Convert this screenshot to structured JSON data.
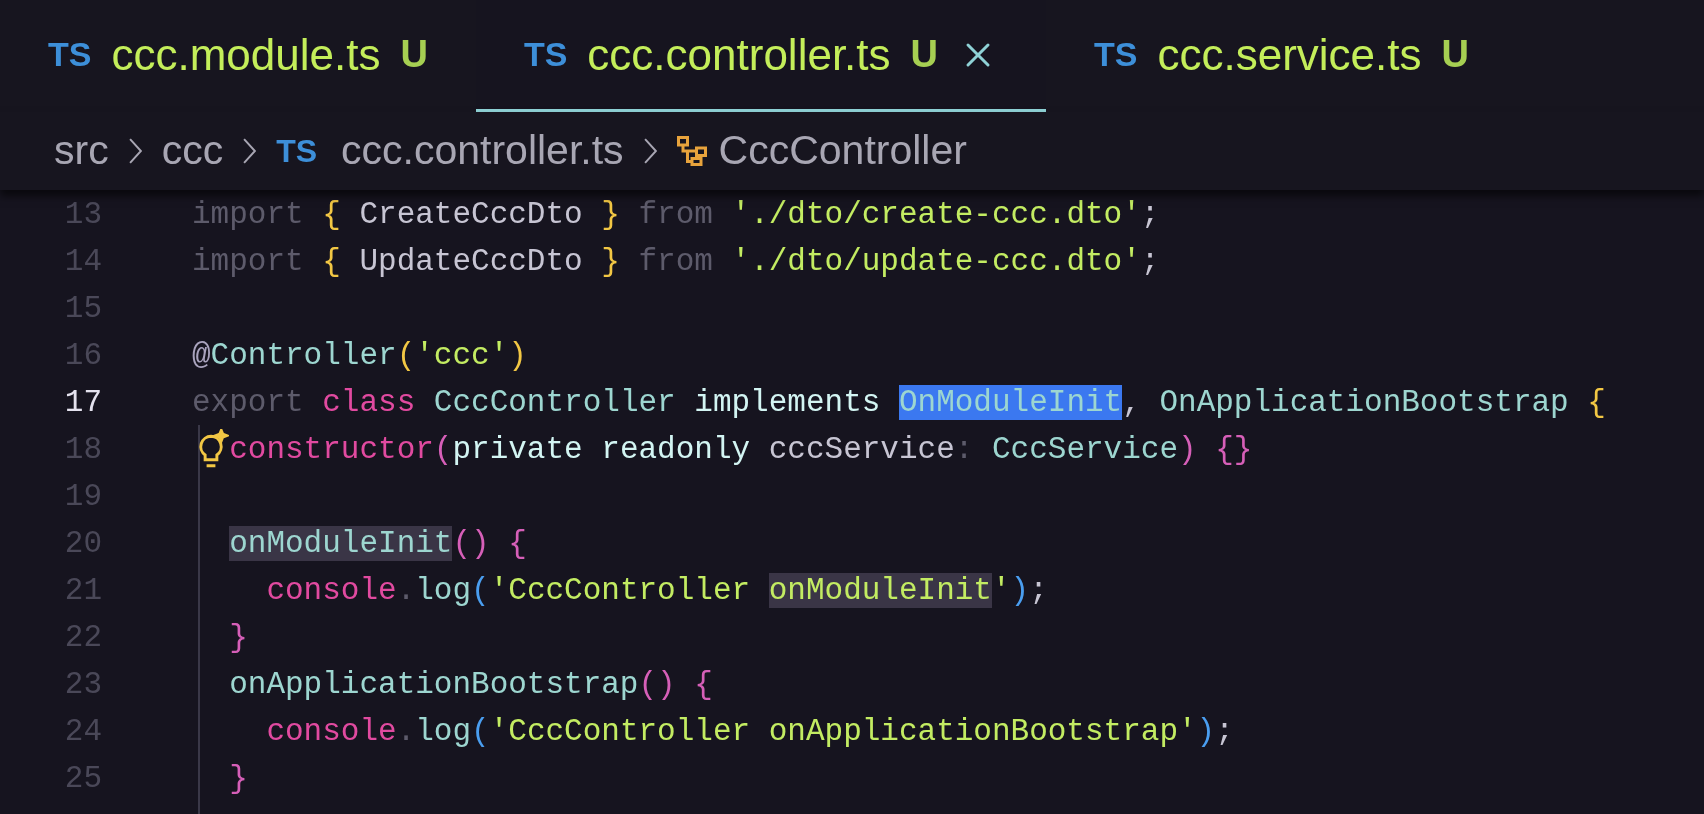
{
  "tabs": [
    {
      "icon_label": "TS",
      "name": "ccc.module.ts",
      "status": "U",
      "selected": false
    },
    {
      "icon_label": "TS",
      "name": "ccc.controller.ts",
      "status": "U",
      "selected": true
    },
    {
      "icon_label": "TS",
      "name": "ccc.service.ts",
      "status": "U",
      "selected": false
    }
  ],
  "breadcrumb": [
    {
      "kind": "folder",
      "text": "src"
    },
    {
      "kind": "folder",
      "text": "ccc"
    },
    {
      "kind": "file",
      "icon_label": "TS",
      "text": "ccc.controller.ts"
    },
    {
      "kind": "class",
      "text": "CccController"
    }
  ],
  "lines": [
    {
      "number": "13",
      "active": false,
      "hint": false,
      "tokens": [
        {
          "text": "import ",
          "kind": "dim",
          "selected": false,
          "occurrence": false
        },
        {
          "text": "{",
          "kind": "brace",
          "selected": false,
          "occurrence": false
        },
        {
          "text": " CreateCccDto ",
          "kind": "ident",
          "selected": false,
          "occurrence": false
        },
        {
          "text": "}",
          "kind": "brace",
          "selected": false,
          "occurrence": false
        },
        {
          "text": " from ",
          "kind": "dim",
          "selected": false,
          "occurrence": false
        },
        {
          "text": "'./dto/create-ccc.dto'",
          "kind": "string",
          "selected": false,
          "occurrence": false
        },
        {
          "text": ";",
          "kind": "ident",
          "selected": false,
          "occurrence": false
        }
      ]
    },
    {
      "number": "14",
      "active": false,
      "hint": false,
      "tokens": [
        {
          "text": "import ",
          "kind": "dim",
          "selected": false,
          "occurrence": false
        },
        {
          "text": "{",
          "kind": "brace",
          "selected": false,
          "occurrence": false
        },
        {
          "text": " UpdateCccDto ",
          "kind": "ident",
          "selected": false,
          "occurrence": false
        },
        {
          "text": "}",
          "kind": "brace",
          "selected": false,
          "occurrence": false
        },
        {
          "text": " from ",
          "kind": "dim",
          "selected": false,
          "occurrence": false
        },
        {
          "text": "'./dto/update-ccc.dto'",
          "kind": "string",
          "selected": false,
          "occurrence": false
        },
        {
          "text": ";",
          "kind": "ident",
          "selected": false,
          "occurrence": false
        }
      ]
    },
    {
      "number": "15",
      "active": false,
      "hint": false
    },
    {
      "number": "16",
      "active": false,
      "hint": false,
      "tokens": [
        {
          "text": "@",
          "kind": "decorator",
          "selected": false,
          "occurrence": false
        },
        {
          "text": "Controller",
          "kind": "type",
          "selected": false,
          "occurrence": false
        },
        {
          "text": "(",
          "kind": "brace",
          "selected": false,
          "occurrence": false
        },
        {
          "text": "'ccc'",
          "kind": "string",
          "selected": false,
          "occurrence": false
        },
        {
          "text": ")",
          "kind": "brace",
          "selected": false,
          "occurrence": false
        }
      ]
    },
    {
      "number": "17",
      "active": true,
      "hint": false,
      "tokens": [
        {
          "text": "export ",
          "kind": "dim",
          "selected": false,
          "occurrence": false
        },
        {
          "text": "class ",
          "kind": "keyword",
          "selected": false,
          "occurrence": false
        },
        {
          "text": "CccController ",
          "kind": "type",
          "selected": false,
          "occurrence": false
        },
        {
          "text": "implements ",
          "kind": "modifier",
          "selected": false,
          "occurrence": false
        },
        {
          "text": "OnModuleInit",
          "kind": "type",
          "selected": true,
          "occurrence": false
        },
        {
          "text": ", ",
          "kind": "ident",
          "selected": false,
          "occurrence": false
        },
        {
          "text": "OnApplicationBootstrap ",
          "kind": "type",
          "selected": false,
          "occurrence": false
        },
        {
          "text": "{",
          "kind": "brace",
          "selected": false,
          "occurrence": false
        }
      ],
      "children": [
        {
          "number": "18",
          "active": false,
          "hint": true,
          "tokens": [
            {
              "text": "constructor",
              "kind": "keyword",
              "selected": false,
              "occurrence": false
            },
            {
              "text": "(",
              "kind": "paren-pink",
              "selected": false,
              "occurrence": false
            },
            {
              "text": "private readonly ",
              "kind": "modifier",
              "selected": false,
              "occurrence": false
            },
            {
              "text": "cccService",
              "kind": "ident",
              "selected": false,
              "occurrence": false
            },
            {
              "text": ": ",
              "kind": "dim",
              "selected": false,
              "occurrence": false
            },
            {
              "text": "CccService",
              "kind": "type",
              "selected": false,
              "occurrence": false
            },
            {
              "text": ") {}",
              "kind": "paren-pink",
              "selected": false,
              "occurrence": false
            }
          ]
        },
        {
          "number": "19",
          "active": false,
          "hint": false
        },
        {
          "number": "20",
          "active": false,
          "hint": false,
          "tokens": [
            {
              "text": "onModuleInit",
              "kind": "type",
              "selected": false,
              "occurrence": true
            },
            {
              "text": "() {",
              "kind": "paren-pink",
              "selected": false,
              "occurrence": false
            }
          ],
          "children": [
            {
              "number": "21",
              "active": false,
              "hint": false,
              "tokens": [
                {
                  "text": "console",
                  "kind": "keyword",
                  "selected": false,
                  "occurrence": false
                },
                {
                  "text": ".",
                  "kind": "dim",
                  "selected": false,
                  "occurrence": false
                },
                {
                  "text": "log",
                  "kind": "type",
                  "selected": false,
                  "occurrence": false
                },
                {
                  "text": "(",
                  "kind": "paren-blue",
                  "selected": false,
                  "occurrence": false
                },
                {
                  "text": "'CccController ",
                  "kind": "string",
                  "selected": false,
                  "occurrence": false
                },
                {
                  "text": "onModuleInit",
                  "kind": "string",
                  "selected": false,
                  "occurrence": true
                },
                {
                  "text": "'",
                  "kind": "string",
                  "selected": false,
                  "occurrence": false
                },
                {
                  "text": ")",
                  "kind": "paren-blue",
                  "selected": false,
                  "occurrence": false
                },
                {
                  "text": ";",
                  "kind": "ident",
                  "selected": false,
                  "occurrence": false
                }
              ]
            }
          ]
        },
        {
          "number": "22",
          "active": false,
          "hint": false,
          "tokens": [
            {
              "text": "}",
              "kind": "paren-pink",
              "selected": false,
              "occurrence": false
            }
          ]
        },
        {
          "number": "23",
          "active": false,
          "hint": false,
          "tokens": [
            {
              "text": "onApplicationBootstrap",
              "kind": "type",
              "selected": false,
              "occurrence": false
            },
            {
              "text": "() {",
              "kind": "paren-pink",
              "selected": false,
              "occurrence": false
            }
          ],
          "children": [
            {
              "number": "24",
              "active": false,
              "hint": false,
              "tokens": [
                {
                  "text": "console",
                  "kind": "keyword",
                  "selected": false,
                  "occurrence": false
                },
                {
                  "text": ".",
                  "kind": "dim",
                  "selected": false,
                  "occurrence": false
                },
                {
                  "text": "log",
                  "kind": "type",
                  "selected": false,
                  "occurrence": false
                },
                {
                  "text": "(",
                  "kind": "paren-blue",
                  "selected": false,
                  "occurrence": false
                },
                {
                  "text": "'CccController onApplicationBootstrap'",
                  "kind": "string",
                  "selected": false,
                  "occurrence": false
                },
                {
                  "text": ")",
                  "kind": "paren-blue",
                  "selected": false,
                  "occurrence": false
                },
                {
                  "text": ";",
                  "kind": "ident",
                  "selected": false,
                  "occurrence": false
                }
              ]
            }
          ]
        },
        {
          "number": "25",
          "active": false,
          "hint": false,
          "tokens": [
            {
              "text": "}",
              "kind": "paren-pink",
              "selected": false,
              "occurrence": false
            }
          ]
        }
      ]
    }
  ]
}
